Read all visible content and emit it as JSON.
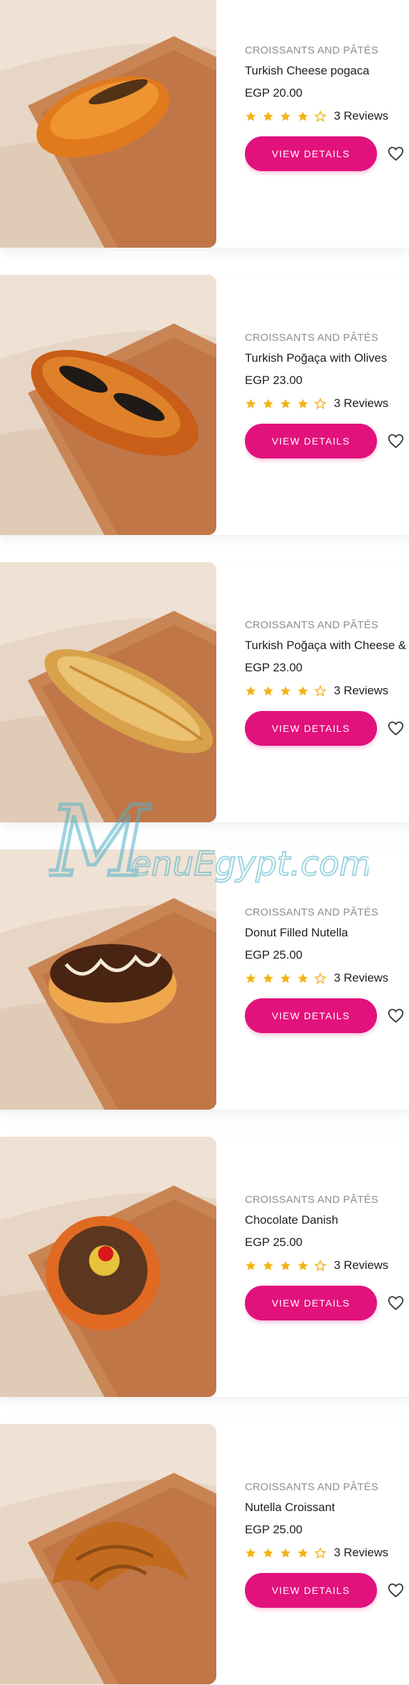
{
  "colors": {
    "accent": "#e2127d",
    "star": "#f3b316",
    "category_text": "#8d8d8d",
    "top_accent": "#d81b3c",
    "watermark": "#4fb2c9"
  },
  "icons": {
    "star_filled": "star-filled-icon",
    "star_outline": "star-outline-icon",
    "wishlist": "heart-outline-icon"
  },
  "watermark": {
    "brand_mark": "M",
    "text": "enuEgypt.com"
  },
  "products": [
    {
      "image_alt": "Turkish Cheese pogaca",
      "pastry": "cheese-pogaca",
      "category": "CROISSANTS AND PÂTÉS",
      "name": "Turkish Cheese pogaca",
      "price": "EGP 20.00",
      "rating": 4,
      "reviews": "3 Reviews",
      "button": "VIEW DETAILS"
    },
    {
      "image_alt": "Turkish Poğaça with Olives",
      "pastry": "olive-pogaca",
      "category": "CROISSANTS AND PÂTÉS",
      "name": "Turkish Poğaça with Olives",
      "price": "EGP 23.00",
      "rating": 4,
      "reviews": "3 Reviews",
      "button": "VIEW DETAILS"
    },
    {
      "image_alt": "Turkish Poğaça with Cheese &",
      "pastry": "sesame-pogaca",
      "category": "CROISSANTS AND PÂTÉS",
      "name": "Turkish Poğaça with Cheese &",
      "price": "EGP 23.00",
      "rating": 4,
      "reviews": "3 Reviews",
      "button": "VIEW DETAILS"
    },
    {
      "image_alt": "Donut Filled Nutella",
      "pastry": "nutella-donut",
      "category": "CROISSANTS AND PÂTÉS",
      "name": "Donut Filled Nutella",
      "price": "EGP 25.00",
      "rating": 4,
      "reviews": "3 Reviews",
      "button": "VIEW DETAILS"
    },
    {
      "image_alt": "Chocolate Danish",
      "pastry": "chocolate-danish",
      "category": "CROISSANTS AND PÂTÉS",
      "name": "Chocolate Danish",
      "price": "EGP 25.00",
      "rating": 4,
      "reviews": "3 Reviews",
      "button": "VIEW DETAILS"
    },
    {
      "image_alt": "Nutella Croissant",
      "pastry": "croissant",
      "category": "CROISSANTS AND PÂTÉS",
      "name": "Nutella Croissant",
      "price": "EGP 25.00",
      "rating": 4,
      "reviews": "3 Reviews",
      "button": "VIEW DETAILS"
    }
  ]
}
